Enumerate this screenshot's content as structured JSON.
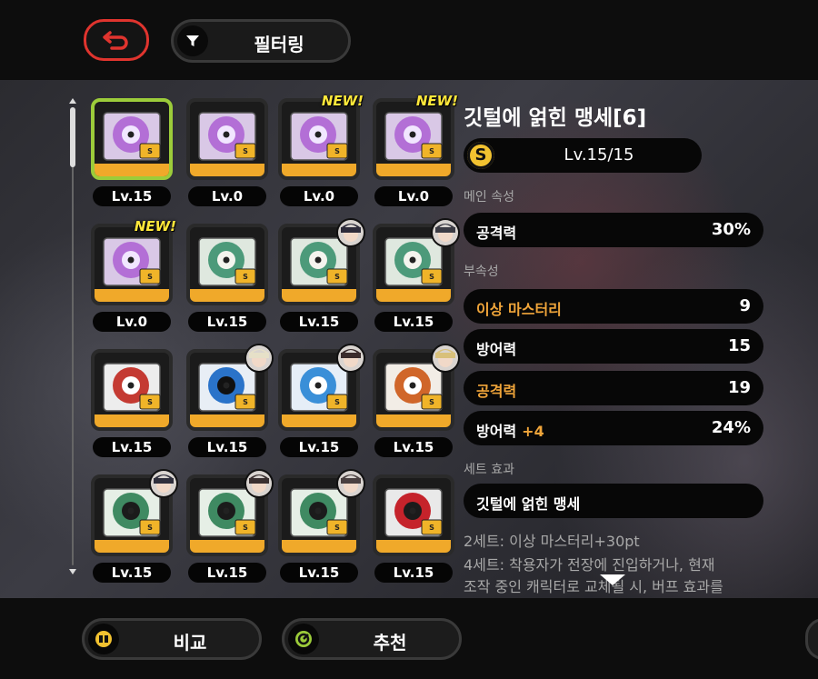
{
  "topbar": {
    "back_icon": "return-arrow-icon",
    "filter": {
      "icon": "funnel-icon",
      "label": "필터링"
    },
    "accent": "#e0342e"
  },
  "discs": [
    {
      "level": "Lv.15",
      "selected": true,
      "new": false,
      "art": "purple"
    },
    {
      "level": "Lv.0",
      "selected": false,
      "new": false,
      "art": "purple"
    },
    {
      "level": "Lv.0",
      "selected": false,
      "new": true,
      "art": "purple"
    },
    {
      "level": "Lv.0",
      "selected": false,
      "new": true,
      "art": "purple"
    },
    {
      "level": "Lv.0",
      "selected": false,
      "new": true,
      "art": "purple"
    },
    {
      "level": "Lv.15",
      "selected": false,
      "new": false,
      "art": "green"
    },
    {
      "level": "Lv.15",
      "selected": false,
      "new": false,
      "art": "green",
      "avatar": true
    },
    {
      "level": "Lv.15",
      "selected": false,
      "new": false,
      "art": "green",
      "avatar": true
    },
    {
      "level": "Lv.15",
      "selected": false,
      "new": false,
      "art": "red-white"
    },
    {
      "level": "Lv.15",
      "selected": false,
      "new": false,
      "art": "blue-black",
      "avatar": true
    },
    {
      "level": "Lv.15",
      "selected": false,
      "new": false,
      "art": "blue-white",
      "avatar": true
    },
    {
      "level": "Lv.15",
      "selected": false,
      "new": false,
      "art": "sunburst",
      "avatar": true
    },
    {
      "level": "Lv.15",
      "selected": false,
      "new": false,
      "art": "green-speaker",
      "avatar": true
    },
    {
      "level": "Lv.15",
      "selected": false,
      "new": false,
      "art": "green-speaker",
      "avatar": true
    },
    {
      "level": "Lv.15",
      "selected": false,
      "new": false,
      "art": "green-speaker",
      "avatar": true
    },
    {
      "level": "Lv.15",
      "selected": false,
      "new": false,
      "art": "red-speaker"
    }
  ],
  "new_badge": "NEW!",
  "detail": {
    "title": "깃털에 얽힌 맹세[6]",
    "rank": "S",
    "level": "Lv.15/15",
    "main_label": "메인 속성",
    "main_stat": {
      "name": "공격력",
      "value": "30%"
    },
    "sub_label": "부속성",
    "sub_stats": [
      {
        "name": "이상 마스터리",
        "plus": "",
        "value": "9",
        "highlight": true
      },
      {
        "name": "방어력",
        "plus": "",
        "value": "15",
        "highlight": false
      },
      {
        "name": "공격력",
        "plus": "",
        "value": "19",
        "highlight": true
      },
      {
        "name": "방어력",
        "plus": "+4",
        "value": "24%",
        "highlight": false
      }
    ],
    "set_label": "세트 효과",
    "set_name": "깃털에 얽힌 맹세",
    "set_desc_1": "2세트: 이상 마스터리+30pt",
    "set_desc_2": "4세트: 착용자가 전장에 진입하거나, 현재",
    "set_desc_3": "조작 중인 캐릭터로 교체될 시, 버프 효과를"
  },
  "bottom": {
    "compare": {
      "icon": "compare-icon",
      "label": "비교"
    },
    "recommend": {
      "icon": "recommend-icon",
      "label": "추천"
    }
  },
  "colors": {
    "highlight": "#f0a53a",
    "selected": "#9ccc3a",
    "tile_base": "#f0a92a",
    "new_badge": "#ffe83a"
  }
}
